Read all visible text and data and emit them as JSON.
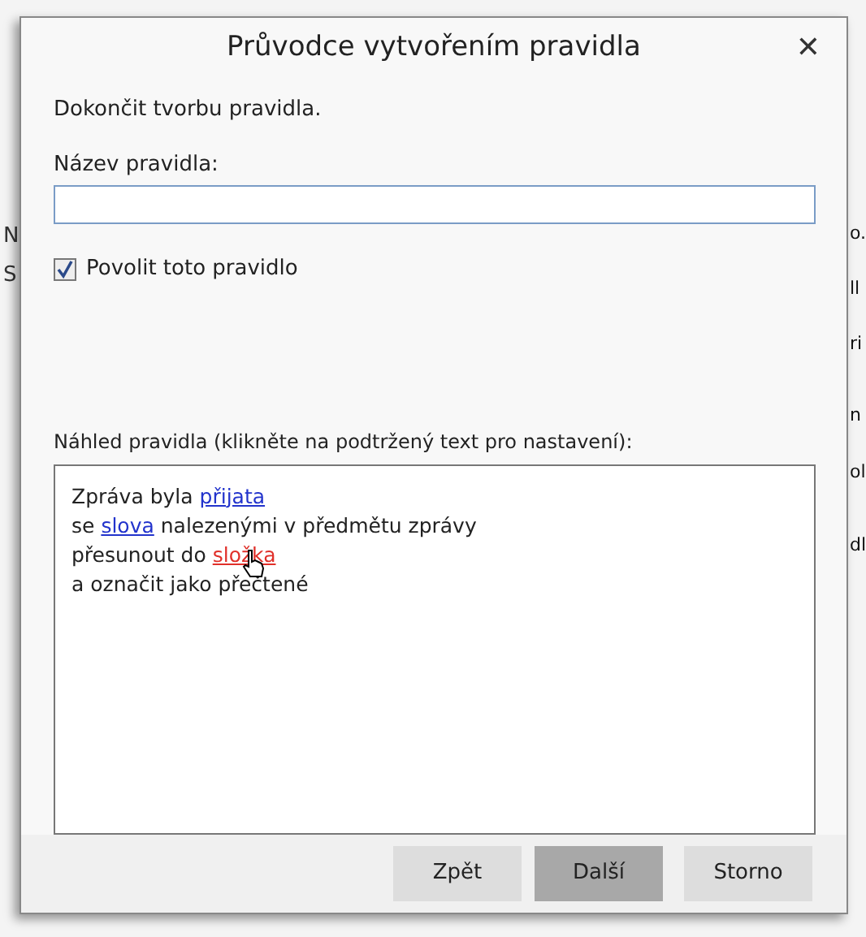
{
  "background": {
    "left_fragments": [
      "N",
      "S"
    ],
    "right_fragments": [
      "o.",
      "ll",
      "ri",
      "n",
      "ol",
      "dl"
    ]
  },
  "dialog": {
    "title": "Průvodce vytvořením pravidla",
    "close": "✕",
    "intro": "Dokončit tvorbu pravidla.",
    "name_label": "Název pravidla:",
    "enable": {
      "label": "Povolit toto pravidlo",
      "checked": true
    },
    "preview_label": "Náhled pravidla (klikněte na podtržený text pro nastavení):",
    "preview_lines": [
      [
        {
          "kind": "text",
          "text": "Zpráva byla "
        },
        {
          "kind": "link",
          "text": "přijata",
          "hovered": false
        }
      ],
      [
        {
          "kind": "text",
          "text": "se "
        },
        {
          "kind": "link",
          "text": "slova",
          "hovered": false
        },
        {
          "kind": "text",
          "text": " nalezenými v předmětu zprávy"
        }
      ],
      [
        {
          "kind": "text",
          "text": "přesunout do "
        },
        {
          "kind": "link",
          "text": "složka",
          "hovered": true
        }
      ],
      [
        {
          "kind": "text",
          "text": "a označit jako přečtené"
        }
      ]
    ],
    "buttons": [
      {
        "label": "Zpět",
        "pressed": false
      },
      {
        "label": "Další",
        "pressed": true
      },
      {
        "label": "Storno",
        "pressed": false
      }
    ]
  }
}
